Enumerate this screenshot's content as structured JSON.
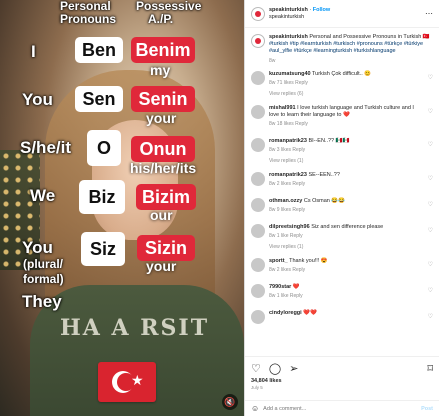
{
  "video": {
    "headers": {
      "personal": "Personal",
      "pronouns": "Pronouns",
      "possessive": "Possessive",
      "ap": "A./P."
    },
    "rows": [
      {
        "label": "I",
        "pronoun": "Ben",
        "possessive": "Benim",
        "meaning": "my"
      },
      {
        "label": "You",
        "pronoun": "Sen",
        "possessive": "Senin",
        "meaning": "your"
      },
      {
        "label": "S/he/it",
        "pronoun": "O",
        "possessive": "Onun",
        "meaning": "his/her/its"
      },
      {
        "label": "We",
        "pronoun": "Biz",
        "possessive": "Bizim",
        "meaning": "our"
      },
      {
        "label": "You",
        "pronoun": "Siz",
        "possessive": "Sizin",
        "meaning": "your"
      }
    ],
    "label_you_plural": "(plural/",
    "label_formal": "formal)",
    "label_they": "They",
    "sweater_text": "HA  A  RSIT"
  },
  "post": {
    "account": "speakinturkish",
    "follow": "Follow",
    "subname": "speakinturkish",
    "caption_user": "speakinturkish",
    "caption_text": "Personal and Possessive Pronouns in Turkish 🇹🇷",
    "caption_tags": "#turkish #tip #learnturkish #turkisch #pronouns #türkçe #türkiye #aul_ylfie #türkçe #learningturkish #turkishlanguage",
    "caption_meta": "8w"
  },
  "comments": [
    {
      "user": "kuzumatsung40",
      "text": "Turkish Çok difficult.. 😊",
      "time": "8w",
      "likes": "71 likes",
      "reply": "Reply",
      "replies": "View replies (6)"
    },
    {
      "user": "mishal991",
      "text": "I love turkish language and Turkish culture and I love to learn their language to ❤️",
      "time": "8w",
      "likes": "18 likes",
      "reply": "Reply",
      "replies": ""
    },
    {
      "user": "romanpatrik23",
      "text": "BI--EN..?? 🇲🇽🇲🇽",
      "time": "8w",
      "likes": "3 likes",
      "reply": "Reply",
      "replies": "View replies (1)"
    },
    {
      "user": "romanpatrik23",
      "text": "SE--EEN..??",
      "time": "8w",
      "likes": "2 likes",
      "reply": "Reply",
      "replies": ""
    },
    {
      "user": "othman.ozzy",
      "text": "Cs Osman 😂😂",
      "time": "8w",
      "likes": "9 likes",
      "reply": "Reply",
      "replies": ""
    },
    {
      "user": "dilpreetsingh96",
      "text": "Siz and sen difference please",
      "time": "8w",
      "likes": "1 like",
      "reply": "Reply",
      "replies": "View replies (1)"
    },
    {
      "user": "sportt_",
      "text": "Thank you!!! 😍",
      "time": "8w",
      "likes": "2 likes",
      "reply": "Reply",
      "replies": ""
    },
    {
      "user": "7990star",
      "text": "❤️",
      "time": "8w",
      "likes": "1 like",
      "reply": "Reply",
      "replies": ""
    },
    {
      "user": "cindyloreggi",
      "text": "❤️❤️",
      "time": "",
      "likes": "",
      "reply": "",
      "replies": ""
    }
  ],
  "bottom": {
    "likes": "34,804 likes",
    "date": "July 5",
    "add_comment_placeholder": "Add a comment...",
    "post": "Post"
  }
}
